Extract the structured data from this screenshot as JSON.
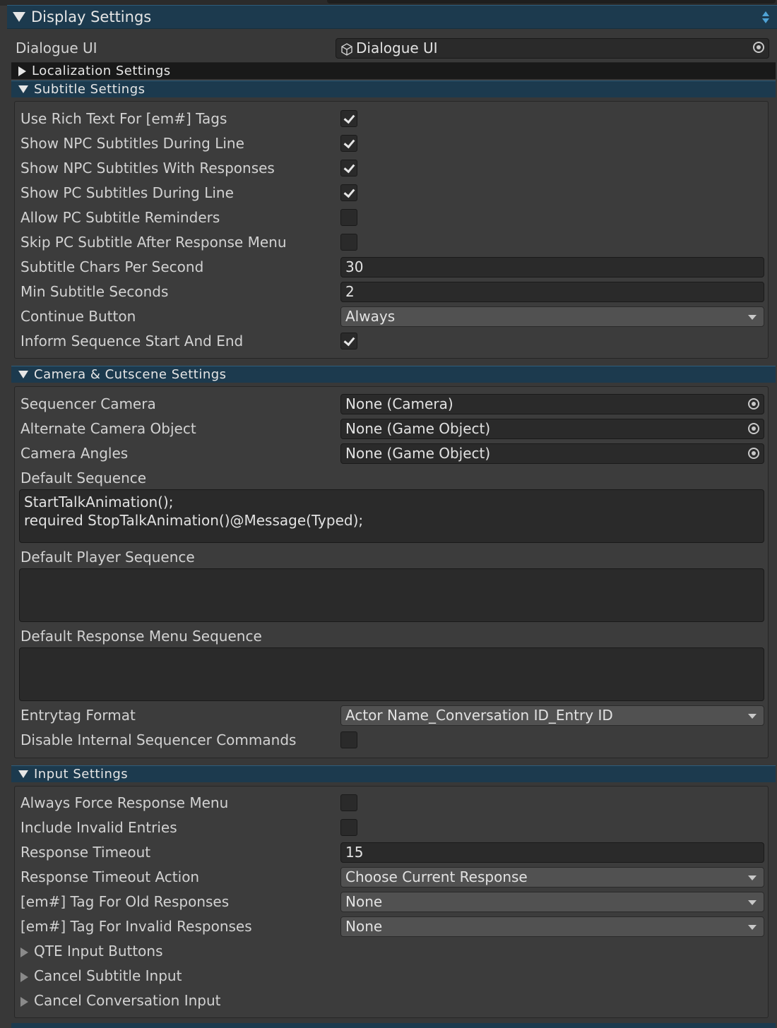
{
  "header": {
    "title": "Display Settings"
  },
  "dialogue_ui": {
    "label": "Dialogue UI",
    "value": "Dialogue UI"
  },
  "localization": {
    "title": "Localization Settings"
  },
  "subtitle": {
    "title": "Subtitle Settings",
    "rows": [
      {
        "label": "Use Rich Text For [em#] Tags",
        "checked": true
      },
      {
        "label": "Show NPC Subtitles During Line",
        "checked": true
      },
      {
        "label": "Show NPC Subtitles With Responses",
        "checked": true
      },
      {
        "label": "Show PC Subtitles During Line",
        "checked": true
      },
      {
        "label": "Allow PC Subtitle Reminders",
        "checked": false
      },
      {
        "label": "Skip PC Subtitle After Response Menu",
        "checked": false
      },
      {
        "label": "Subtitle Chars Per Second",
        "value": "30"
      },
      {
        "label": "Min Subtitle Seconds",
        "value": "2"
      },
      {
        "label": "Continue Button",
        "value": "Always"
      },
      {
        "label": "Inform Sequence Start And End",
        "checked": true
      }
    ]
  },
  "camera": {
    "title": "Camera & Cutscene Settings",
    "sequencer_camera": {
      "label": "Sequencer Camera",
      "value": "None (Camera)"
    },
    "alternate_camera": {
      "label": "Alternate Camera Object",
      "value": "None (Game Object)"
    },
    "camera_angles": {
      "label": "Camera Angles",
      "value": "None (Game Object)"
    },
    "default_sequence": {
      "label": "Default Sequence",
      "line1": "StartTalkAnimation();",
      "line2": "required StopTalkAnimation()@Message(Typed);"
    },
    "default_player_sequence": {
      "label": "Default Player Sequence",
      "value": ""
    },
    "default_response_sequence": {
      "label": "Default Response Menu Sequence",
      "value": ""
    },
    "entrytag_format": {
      "label": "Entrytag Format",
      "value": "Actor Name_Conversation ID_Entry ID"
    },
    "disable_internal": {
      "label": "Disable Internal Sequencer Commands",
      "checked": false
    }
  },
  "input": {
    "title": "Input Settings",
    "always_force": {
      "label": "Always Force Response Menu",
      "checked": false
    },
    "include_invalid": {
      "label": "Include Invalid Entries",
      "checked": false
    },
    "response_timeout": {
      "label": "Response Timeout",
      "value": "15"
    },
    "timeout_action": {
      "label": "Response Timeout Action",
      "value": "Choose Current Response"
    },
    "old_responses": {
      "label": "[em#] Tag For Old Responses",
      "value": "None"
    },
    "invalid_responses": {
      "label": "[em#] Tag For Invalid Responses",
      "value": "None"
    },
    "qte": {
      "label": "QTE Input Buttons"
    },
    "cancel_subtitle": {
      "label": "Cancel Subtitle Input"
    },
    "cancel_conversation": {
      "label": "Cancel Conversation Input"
    }
  }
}
